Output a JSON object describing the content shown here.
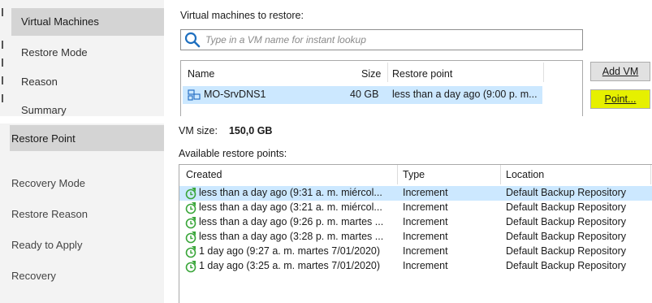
{
  "top_panel": {
    "sidebar": {
      "items": [
        "Virtual Machines",
        "Restore Mode",
        "Reason",
        "Summary"
      ],
      "selected": "Virtual Machines"
    },
    "vm_label": "Virtual machines to restore:",
    "search": {
      "placeholder": "Type in a VM name for instant lookup"
    },
    "table": {
      "columns": [
        "Name",
        "Size",
        "Restore point"
      ],
      "rows": [
        {
          "name": "MO-SrvDNS1",
          "size": "40 GB",
          "restore_point": "less than a day ago (9:00 p. m..."
        }
      ]
    },
    "buttons": {
      "add_vm": "Add VM",
      "point": "Point..."
    }
  },
  "bottom_panel": {
    "sidebar": {
      "items": [
        "Restore Point",
        "Recovery Mode",
        "Restore Reason",
        "Ready to Apply",
        "Recovery"
      ],
      "selected": "Restore Point"
    },
    "vm_size_label": "VM size:",
    "vm_size_value": "150,0 GB",
    "available_label": "Available restore points:",
    "table": {
      "columns": [
        "Created",
        "Type",
        "Location"
      ],
      "rows": [
        {
          "created": "less than a day ago (9:31 a. m. miércol...",
          "type": "Increment",
          "location": "Default Backup Repository"
        },
        {
          "created": "less than a day ago (3:21 a. m. miércol...",
          "type": "Increment",
          "location": "Default Backup Repository"
        },
        {
          "created": "less than a day ago (9:26 p. m. martes ...",
          "type": "Increment",
          "location": "Default Backup Repository"
        },
        {
          "created": "less than a day ago (3:28 p. m. martes ...",
          "type": "Increment",
          "location": "Default Backup Repository"
        },
        {
          "created": "1 day ago (9:27 a. m. martes 7/01/2020)",
          "type": "Increment",
          "location": "Default Backup Repository"
        },
        {
          "created": "1 day ago (3:25 a. m. martes 7/01/2020)",
          "type": "Increment",
          "location": "Default Backup Repository"
        }
      ]
    }
  },
  "colors": {
    "sidebar_bg": "#f3f3f3",
    "sidebar_selected": "#d4d4d4",
    "row_selected": "#cce8ff",
    "button_highlight": "#e6f000",
    "restore_icon_green": "#3aa63a"
  }
}
